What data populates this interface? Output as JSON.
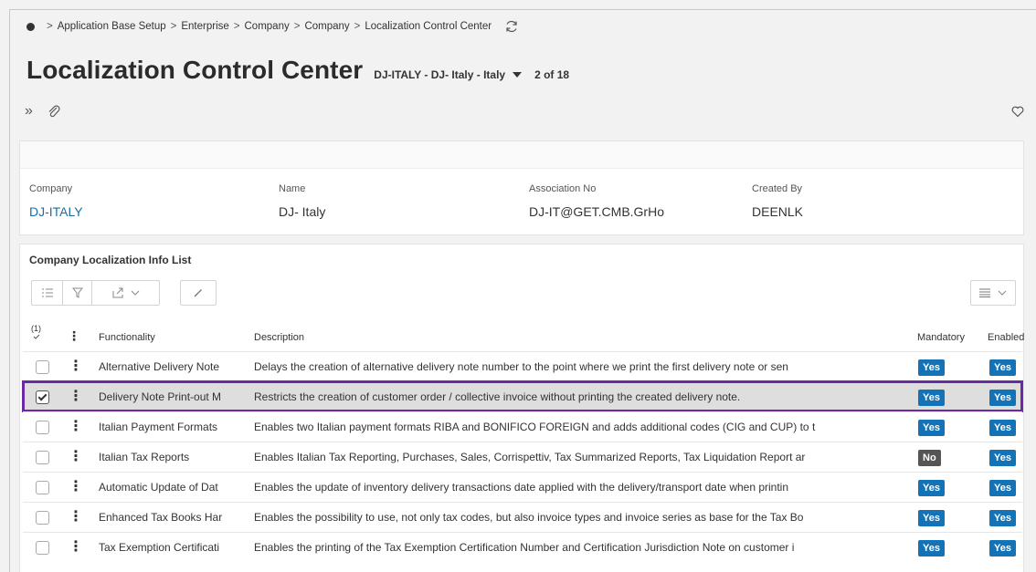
{
  "breadcrumb": [
    "Application Base Setup",
    "Enterprise",
    "Company",
    "Company",
    "Localization Control Center"
  ],
  "breadcrumb_sep": ">",
  "header": {
    "title": "Localization Control Center",
    "record": "DJ-ITALY - DJ- Italy - Italy",
    "count": "2 of 18"
  },
  "fields": {
    "company_label": "Company",
    "company_value": "DJ-ITALY",
    "name_label": "Name",
    "name_value": "DJ- Italy",
    "assoc_label": "Association No",
    "assoc_value": "DJ-IT@GET.CMB.GrHo",
    "created_label": "Created By",
    "created_value": "DEENLK"
  },
  "list": {
    "title": "Company Localization Info List",
    "selected_count": "(1)",
    "columns": {
      "functionality": "Functionality",
      "description": "Description",
      "mandatory": "Mandatory",
      "enabled": "Enabled"
    },
    "rows": [
      {
        "functionality": "Alternative Delivery Note",
        "description": "Delays the creation of alternative delivery note number to the point where we print the first delivery note or sen",
        "mandatory": "Yes",
        "enabled": "Yes",
        "selected": false
      },
      {
        "functionality": "Delivery Note Print-out M",
        "description": "Restricts the creation of customer order / collective invoice without printing the created delivery note.",
        "mandatory": "Yes",
        "enabled": "Yes",
        "selected": true
      },
      {
        "functionality": "Italian Payment Formats",
        "description": "Enables two Italian payment formats RIBA and BONIFICO FOREIGN and adds additional codes (CIG and CUP) to t",
        "mandatory": "Yes",
        "enabled": "Yes",
        "selected": false
      },
      {
        "functionality": "Italian Tax Reports",
        "description": "Enables Italian Tax Reporting, Purchases, Sales, Corrispettiv, Tax Summarized Reports, Tax Liquidation Report ar",
        "mandatory": "No",
        "enabled": "Yes",
        "selected": false
      },
      {
        "functionality": "Automatic Update of Dat",
        "description": "Enables the update of inventory delivery transactions date applied with the delivery/transport date when printin",
        "mandatory": "Yes",
        "enabled": "Yes",
        "selected": false
      },
      {
        "functionality": "Enhanced Tax Books Har",
        "description": "Enables the possibility to use, not only tax codes, but also invoice types and invoice series as base for the Tax Bo",
        "mandatory": "Yes",
        "enabled": "Yes",
        "selected": false
      },
      {
        "functionality": "Tax Exemption Certificati",
        "description": "Enables the printing of the Tax Exemption Certification Number and Certification Jurisdiction Note on customer i",
        "mandatory": "Yes",
        "enabled": "Yes",
        "selected": false
      }
    ]
  },
  "colors": {
    "accent_link": "#1a6ea8",
    "badge_yes": "#1373b6",
    "badge_no": "#555555",
    "selection_outline": "#6a2aa4"
  }
}
